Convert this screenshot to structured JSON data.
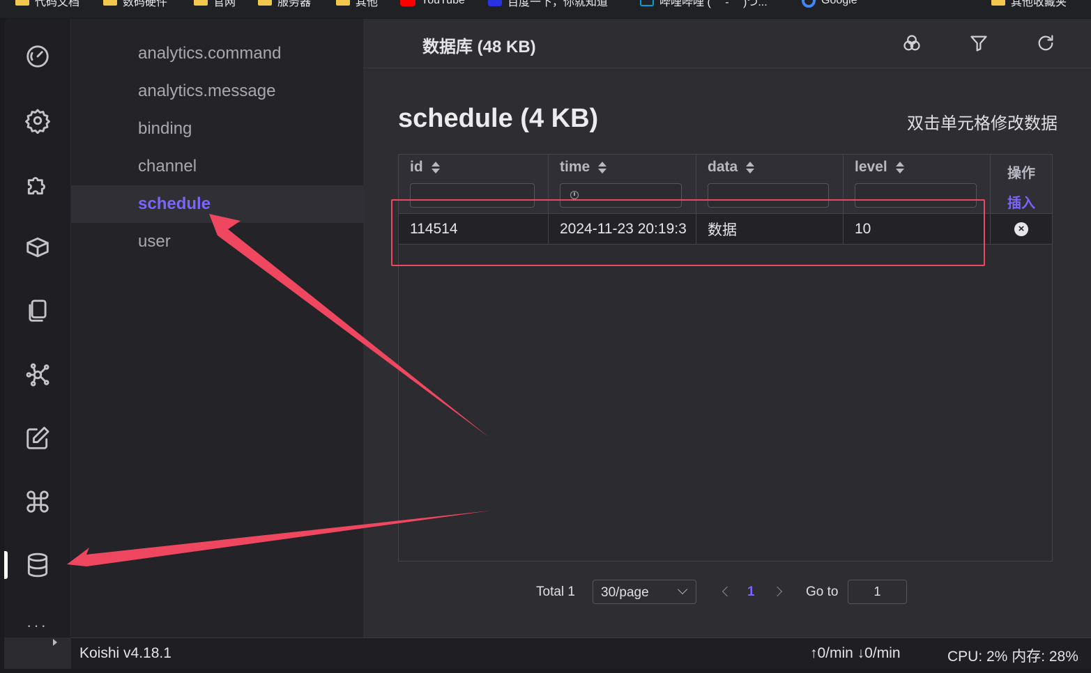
{
  "bookmarks": [
    {
      "label": "代码文档",
      "icon": "folder-icon"
    },
    {
      "label": "数码硬件",
      "icon": "folder-icon"
    },
    {
      "label": "官网",
      "icon": "folder-icon"
    },
    {
      "label": "服务器",
      "icon": "folder-icon"
    },
    {
      "label": "其他",
      "icon": "folder-icon"
    },
    {
      "label": "YouTube",
      "icon": "youtube-icon"
    },
    {
      "label": "百度一下，你就知道",
      "icon": "baidu-icon"
    },
    {
      "label": "哔哩哔哩 ( ゜- ゜)つ...",
      "icon": "bilibili-icon"
    },
    {
      "label": "Google",
      "icon": "google-icon"
    },
    {
      "label": "其他收藏夹",
      "icon": "folder-icon"
    }
  ],
  "activity_bar": {
    "items": [
      "dashboard-icon",
      "settings-icon",
      "plugins-icon",
      "market-icon",
      "files-icon",
      "dependencies-icon",
      "edit-icon",
      "commands-icon",
      "database-icon"
    ],
    "active": "database-icon",
    "more": "···"
  },
  "sidebar": {
    "tables": [
      "analytics.command",
      "analytics.message",
      "binding",
      "channel",
      "schedule",
      "user"
    ],
    "active": "schedule"
  },
  "header": {
    "title": "数据库 (48 KB)",
    "actions": [
      "merge-icon",
      "filter-icon",
      "refresh-icon"
    ]
  },
  "table_view": {
    "title": "schedule (4 KB)",
    "hint": "双击单元格修改数据",
    "columns": [
      "id",
      "time",
      "data",
      "level"
    ],
    "ops_header": "操作",
    "insert_label": "插入",
    "rows": [
      {
        "id": "114514",
        "time": "2024-11-23 20:19:3",
        "data": "数据",
        "level": "10"
      }
    ]
  },
  "pagination": {
    "total": "Total 1",
    "page_size": "30/page",
    "current": "1",
    "goto_label": "Go to",
    "goto_value": "1"
  },
  "status": {
    "version": "Koishi v4.18.1",
    "rate": "↑0/min ↓0/min",
    "cpu": "CPU: 2% 内存: 28%"
  },
  "colors": {
    "accent": "#7a65ff",
    "annotation": "#ef4760"
  }
}
